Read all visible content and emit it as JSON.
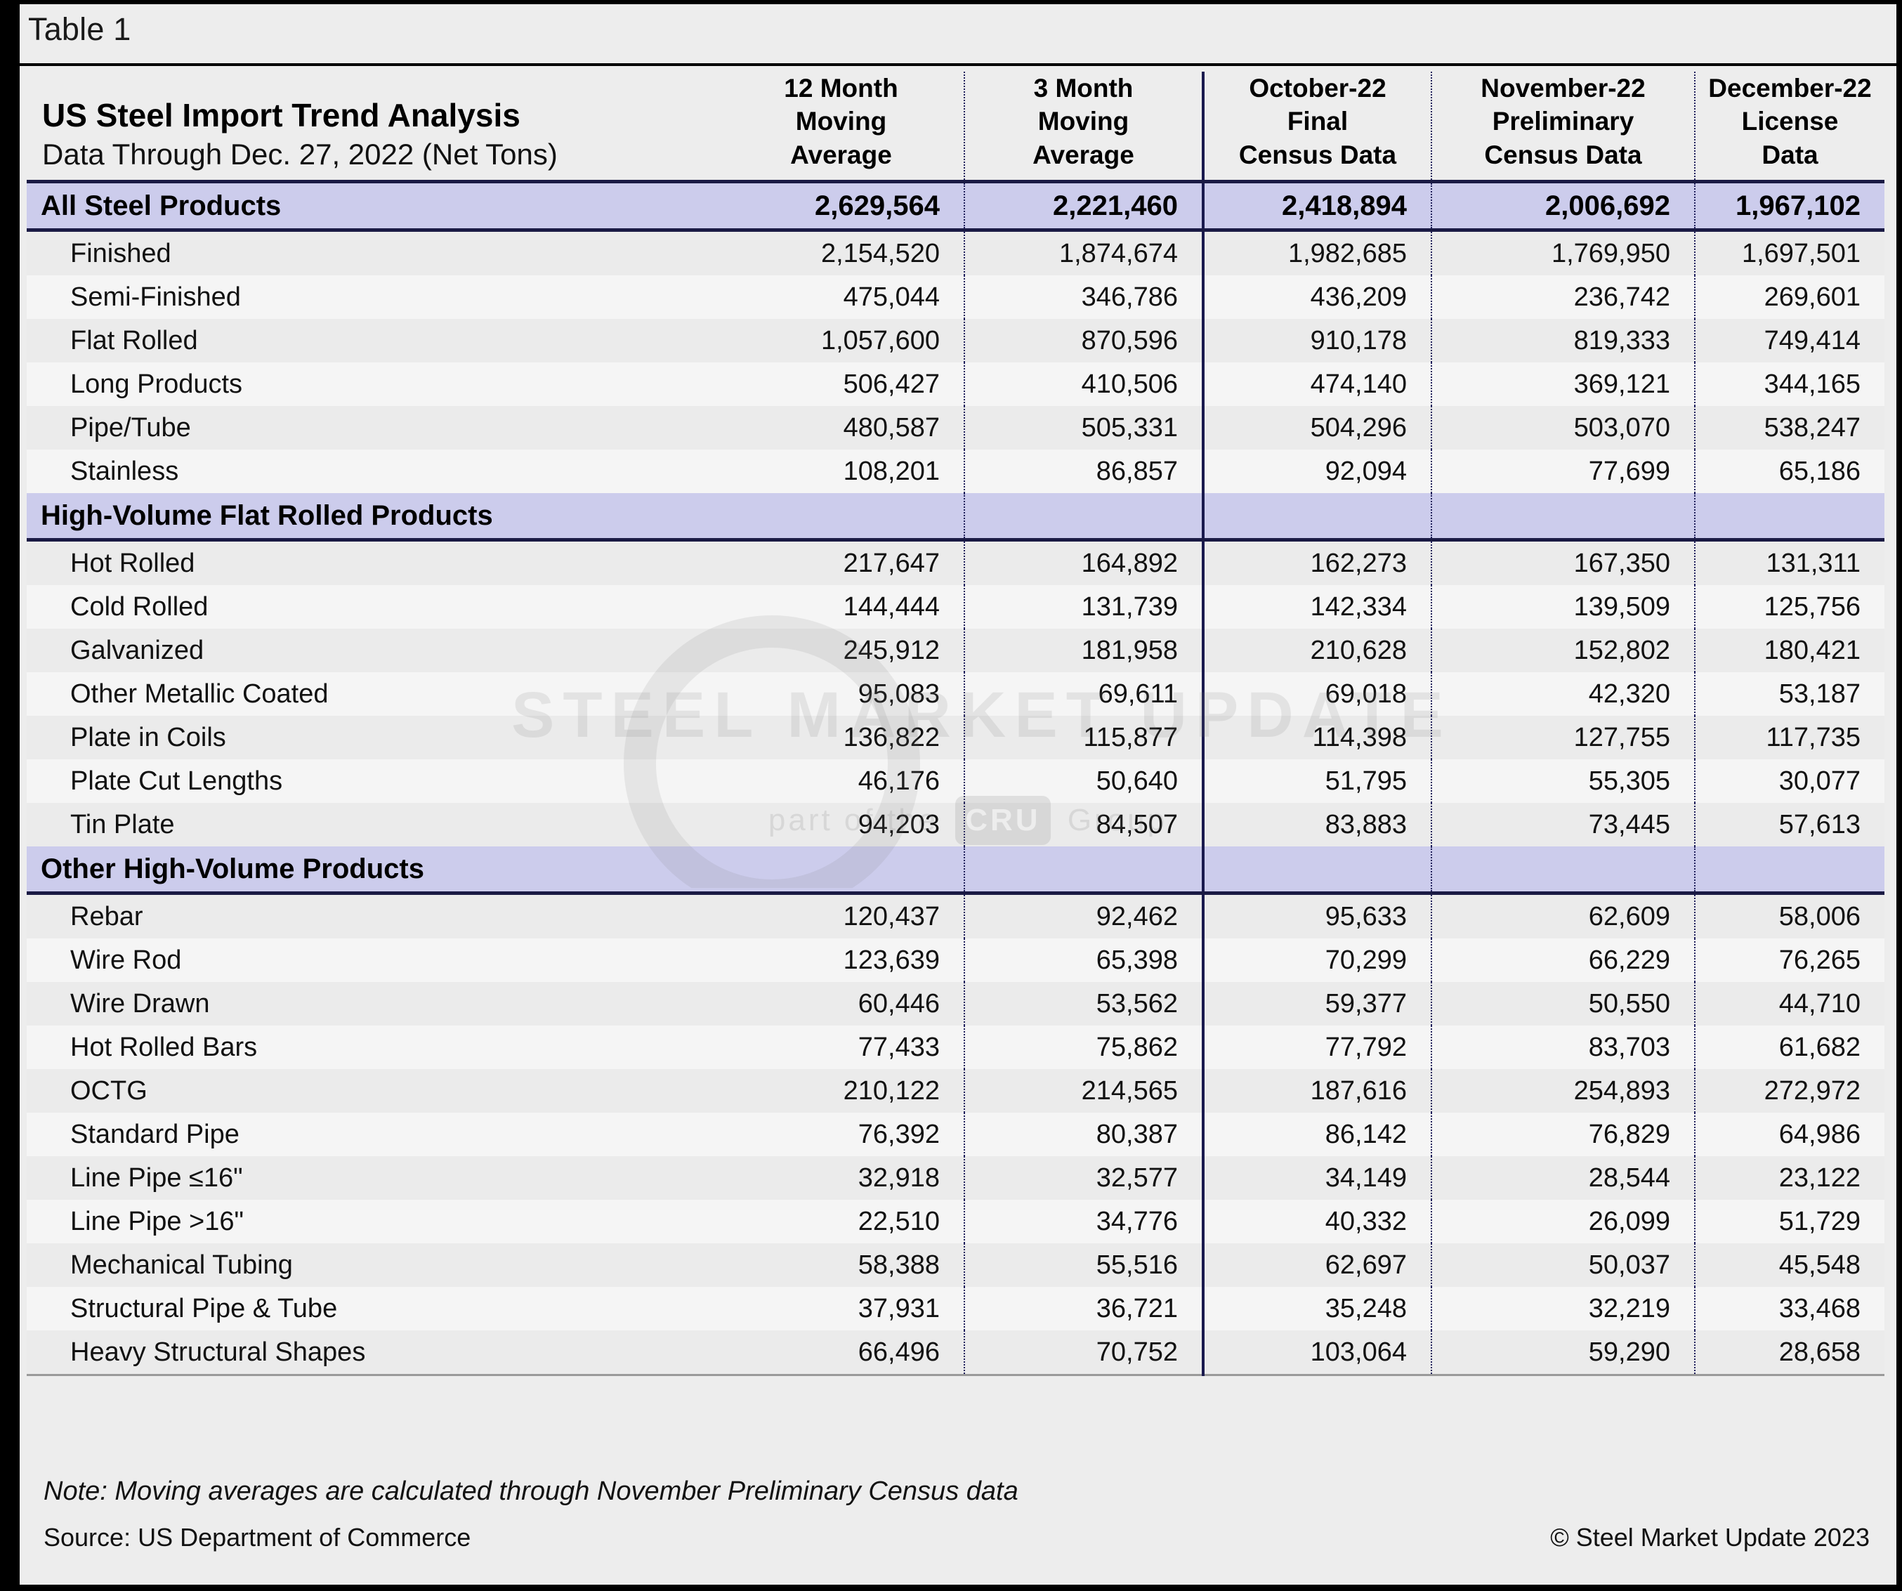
{
  "caption": "Table 1",
  "header": {
    "title": "US Steel Import Trend Analysis",
    "subtitle": "Data Through Dec. 27, 2022 (Net Tons)",
    "columns": [
      {
        "l1": "12 Month",
        "l2": "Moving",
        "l3": "Average"
      },
      {
        "l1": "3 Month",
        "l2": "Moving",
        "l3": "Average"
      },
      {
        "l1": "October-22",
        "l2": "Final",
        "l3": "Census Data"
      },
      {
        "l1": "November-22",
        "l2": "Preliminary",
        "l3": "Census Data"
      },
      {
        "l1": "December-22",
        "l2": "License",
        "l3": "Data"
      }
    ]
  },
  "watermark": {
    "main": "STEEL MARKET UPDATE",
    "sub_before": "part of the",
    "sub_badge": "CRU",
    "sub_after": "Group"
  },
  "footer": {
    "note": "Note: Moving averages are calculated through November Preliminary Census data",
    "source": "Source: US Department of Commerce",
    "copyright": "© Steel Market Update 2023"
  },
  "colors": {
    "group_row": "#ccccec",
    "rule": "#1a1a44",
    "stripe_a": "#ebebeb",
    "stripe_b": "#f5f5f5",
    "page_bg": "#ededed"
  },
  "chart_data": {
    "type": "table",
    "title": "US Steel Import Trend Analysis",
    "subtitle": "Data Through Dec. 27, 2022 (Net Tons)",
    "columns": [
      "Category",
      "12 Month Moving Average",
      "3 Month Moving Average",
      "October-22 Final Census Data",
      "November-22 Preliminary Census Data",
      "December-22 License Data"
    ],
    "rows": [
      {
        "kind": "group",
        "label": "All Steel Products",
        "values": [
          "2,629,564",
          "2,221,460",
          "2,418,894",
          "2,006,692",
          "1,967,102"
        ]
      },
      {
        "kind": "item",
        "label": "Finished",
        "values": [
          "2,154,520",
          "1,874,674",
          "1,982,685",
          "1,769,950",
          "1,697,501"
        ]
      },
      {
        "kind": "item",
        "label": "Semi-Finished",
        "values": [
          "475,044",
          "346,786",
          "436,209",
          "236,742",
          "269,601"
        ]
      },
      {
        "kind": "item",
        "label": "Flat Rolled",
        "values": [
          "1,057,600",
          "870,596",
          "910,178",
          "819,333",
          "749,414"
        ]
      },
      {
        "kind": "item",
        "label": "Long Products",
        "values": [
          "506,427",
          "410,506",
          "474,140",
          "369,121",
          "344,165"
        ]
      },
      {
        "kind": "item",
        "label": "Pipe/Tube",
        "values": [
          "480,587",
          "505,331",
          "504,296",
          "503,070",
          "538,247"
        ]
      },
      {
        "kind": "item",
        "label": "Stainless",
        "values": [
          "108,201",
          "86,857",
          "92,094",
          "77,699",
          "65,186"
        ]
      },
      {
        "kind": "group",
        "label": "High-Volume Flat Rolled Products",
        "values": [
          "",
          "",
          "",
          "",
          ""
        ]
      },
      {
        "kind": "item",
        "label": "Hot Rolled",
        "values": [
          "217,647",
          "164,892",
          "162,273",
          "167,350",
          "131,311"
        ]
      },
      {
        "kind": "item",
        "label": "Cold Rolled",
        "values": [
          "144,444",
          "131,739",
          "142,334",
          "139,509",
          "125,756"
        ]
      },
      {
        "kind": "item",
        "label": "Galvanized",
        "values": [
          "245,912",
          "181,958",
          "210,628",
          "152,802",
          "180,421"
        ]
      },
      {
        "kind": "item",
        "label": "Other Metallic Coated",
        "values": [
          "95,083",
          "69,611",
          "69,018",
          "42,320",
          "53,187"
        ]
      },
      {
        "kind": "item",
        "label": "Plate in Coils",
        "values": [
          "136,822",
          "115,877",
          "114,398",
          "127,755",
          "117,735"
        ]
      },
      {
        "kind": "item",
        "label": "Plate Cut Lengths",
        "values": [
          "46,176",
          "50,640",
          "51,795",
          "55,305",
          "30,077"
        ]
      },
      {
        "kind": "item",
        "label": "Tin Plate",
        "values": [
          "94,203",
          "84,507",
          "83,883",
          "73,445",
          "57,613"
        ]
      },
      {
        "kind": "group",
        "label": "Other High-Volume Products",
        "values": [
          "",
          "",
          "",
          "",
          ""
        ]
      },
      {
        "kind": "item",
        "label": "Rebar",
        "values": [
          "120,437",
          "92,462",
          "95,633",
          "62,609",
          "58,006"
        ]
      },
      {
        "kind": "item",
        "label": "Wire Rod",
        "values": [
          "123,639",
          "65,398",
          "70,299",
          "66,229",
          "76,265"
        ]
      },
      {
        "kind": "item",
        "label": "Wire Drawn",
        "values": [
          "60,446",
          "53,562",
          "59,377",
          "50,550",
          "44,710"
        ]
      },
      {
        "kind": "item",
        "label": "Hot Rolled Bars",
        "values": [
          "77,433",
          "75,862",
          "77,792",
          "83,703",
          "61,682"
        ]
      },
      {
        "kind": "item",
        "label": "OCTG",
        "values": [
          "210,122",
          "214,565",
          "187,616",
          "254,893",
          "272,972"
        ]
      },
      {
        "kind": "item",
        "label": "Standard Pipe",
        "values": [
          "76,392",
          "80,387",
          "86,142",
          "76,829",
          "64,986"
        ]
      },
      {
        "kind": "item",
        "label": "Line Pipe ≤16\"",
        "values": [
          "32,918",
          "32,577",
          "34,149",
          "28,544",
          "23,122"
        ]
      },
      {
        "kind": "item",
        "label": "Line Pipe >16\"",
        "values": [
          "22,510",
          "34,776",
          "40,332",
          "26,099",
          "51,729"
        ]
      },
      {
        "kind": "item",
        "label": "Mechanical Tubing",
        "values": [
          "58,388",
          "55,516",
          "62,697",
          "50,037",
          "45,548"
        ]
      },
      {
        "kind": "item",
        "label": "Structural Pipe & Tube",
        "values": [
          "37,931",
          "36,721",
          "35,248",
          "32,219",
          "33,468"
        ]
      },
      {
        "kind": "item",
        "label": "Heavy Structural Shapes",
        "values": [
          "66,496",
          "70,752",
          "103,064",
          "59,290",
          "28,658"
        ]
      }
    ]
  }
}
